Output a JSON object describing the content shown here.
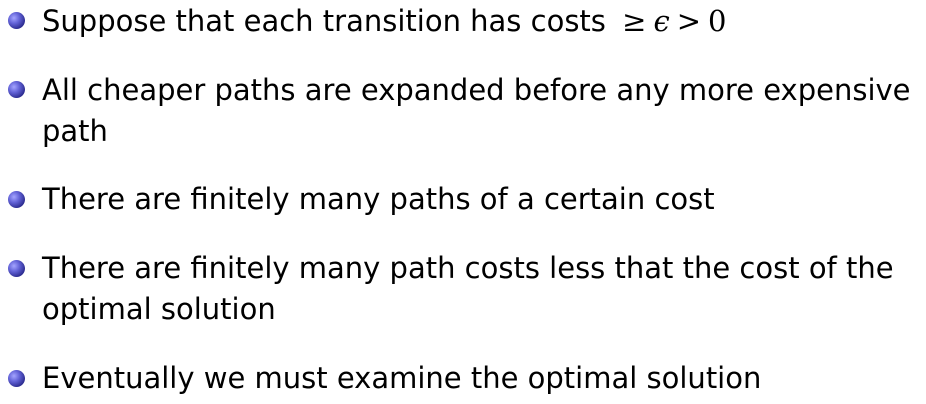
{
  "bullets": [
    {
      "text": "Suppose that each transition has costs ",
      "math": {
        "rel1": "≥",
        "symbol": "ϵ",
        "rel2": ">",
        "value": "0"
      }
    },
    {
      "line1": "All cheaper paths are expanded before any more expensive",
      "line2": "path"
    },
    {
      "text": "There are finitely many paths of a certain cost"
    },
    {
      "line1": "There are finitely many path costs less that the cost of the",
      "line2": "optimal solution"
    },
    {
      "text": "Eventually we must examine the optimal solution"
    }
  ]
}
